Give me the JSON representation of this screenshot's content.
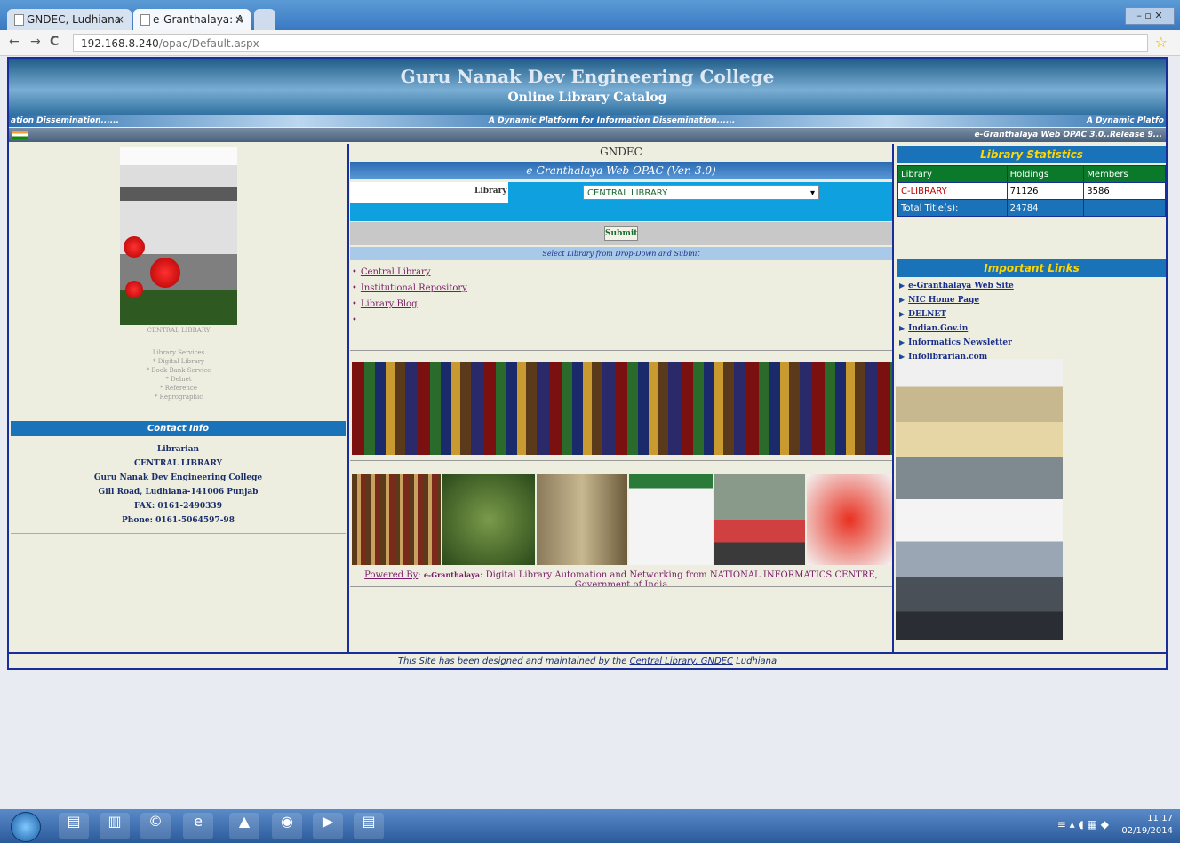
{
  "browser": {
    "tabs": [
      {
        "title": "GNDEC, Ludhiana",
        "close": "×"
      },
      {
        "title": "e-Granthalaya: A Dig",
        "close": "×"
      }
    ],
    "nav_back": "←",
    "nav_forward": "→",
    "nav_reload": "C",
    "url_host": "192.168.8.240",
    "url_path": "/opac/Default.aspx",
    "star": "☆",
    "window_controls": "– ▫ ✕"
  },
  "banner": {
    "title": "Guru Nanak Dev Engineering College",
    "subtitle": "Online Library Catalog",
    "marquee": "A Dynamic Platform for Information Dissemination......",
    "marquee_left": "ation Dissemination......",
    "marquee_right": "A Dynamic Platfo",
    "release": "e-Granthalaya Web OPAC 3.0..Release 9..."
  },
  "left": {
    "caption": "CENTRAL LIBRARY",
    "services": [
      "Library Services",
      "* Digital Library",
      "* Book Bank Service",
      "* Delnet",
      "* Reference",
      "* Reprographic"
    ],
    "contact_heading": "Contact Info",
    "contact": [
      "Librarian",
      "CENTRAL LIBRARY",
      "Guru Nanak Dev Engineering College",
      "Gill Road, Ludhiana-141006 Punjab",
      "FAX: 0161-2490339",
      "Phone: 0161-5064597-98"
    ]
  },
  "middle": {
    "org": "GNDEC",
    "heading": "e-Granthalaya Web OPAC (Ver. 3.0)",
    "library_label": "Library",
    "library_selected": "CENTRAL LIBRARY",
    "submit_label": "Submit",
    "hint": "Select Library from Drop-Down and Submit",
    "links": [
      "Central Library",
      "Institutional Repository",
      "Library Blog",
      ""
    ],
    "powered_by": "Powered By",
    "powered_product": "e-Granthalaya",
    "powered_text": "Digital Library Automation and Networking from NATIONAL INFORMATICS CENTRE, Government of India"
  },
  "right": {
    "stats_heading": "Library Statistics",
    "stats_columns": [
      "Library",
      "Holdings",
      "Members"
    ],
    "stats_rows": [
      [
        "C-LIBRARY",
        "71126",
        "3586"
      ]
    ],
    "total_label": "Total Title(s):",
    "total_value": "24784",
    "links_heading": "Important Links",
    "links": [
      "e-Granthalaya Web Site",
      "NIC Home Page",
      "DELNET",
      "Indian.Gov.in",
      "Informatics Newsletter",
      "Infolibrarian.com"
    ]
  },
  "footer": {
    "text": "This Site has been designed and maintained by the",
    "link": "Central Library, GNDEC",
    "suffix": "Ludhiana"
  },
  "taskbar": {
    "time": "11:17",
    "date": "02/19/2014"
  }
}
